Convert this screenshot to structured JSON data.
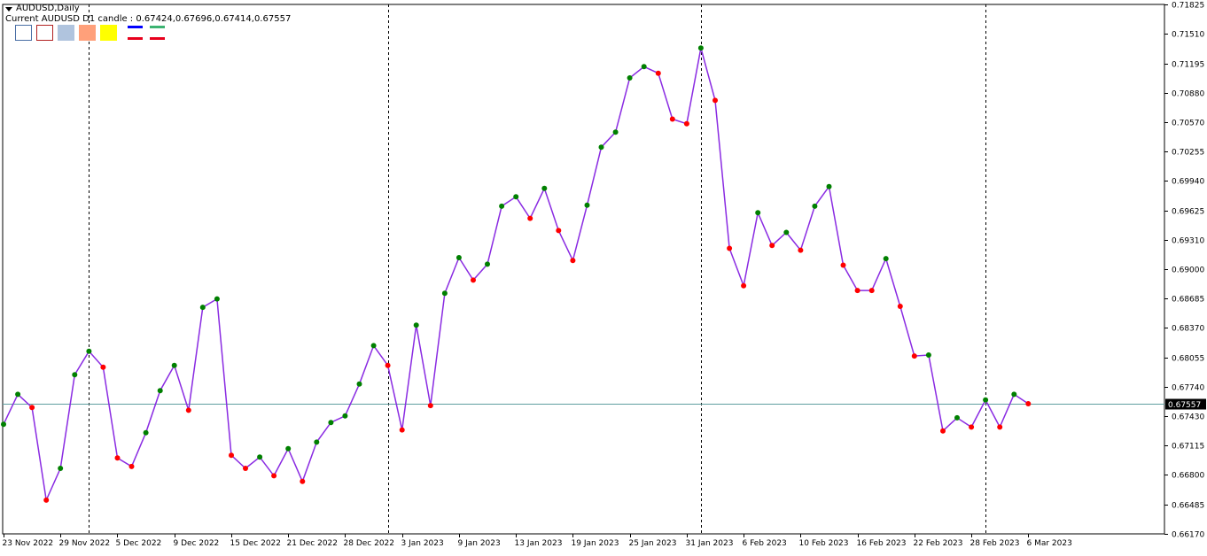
{
  "header": {
    "symbol_title": "AUDUSD,Daily",
    "info_line": "Current AUDUSD D1 candle : 0.67424,0.67696,0.67414,0.67557"
  },
  "legend": {
    "swatches": [
      {
        "name": "white-box-swatch",
        "fill": "#ffffff",
        "border": "#4a6fa5"
      },
      {
        "name": "white-red-box-swatch",
        "fill": "#ffffff",
        "border": "#b22222"
      },
      {
        "name": "lightsteelblue-swatch",
        "fill": "#b0c4de",
        "border": "#b0c4de"
      },
      {
        "name": "lightsalmon-swatch",
        "fill": "#ffa07a",
        "border": "#ffa07a"
      },
      {
        "name": "yellow-swatch",
        "fill": "#ffff00",
        "border": "#ffff00"
      }
    ],
    "line_pairs": [
      {
        "top": "#0000ff",
        "bottom": "#e8001c"
      },
      {
        "top": "#3cb371",
        "bottom": "#e8001c"
      }
    ]
  },
  "colors": {
    "line": "#8a2be2",
    "up_dot": "#008000",
    "down_dot": "#ff0000",
    "current_price_line": "#5f9ea0",
    "grid_line": "#000000"
  },
  "chart_data": {
    "type": "line",
    "title": "AUDUSD,Daily",
    "current_price": 0.67557,
    "current_price_label": "0.67557",
    "y_ticks": [
      "0.71825",
      "0.71510",
      "0.71195",
      "0.70880",
      "0.70570",
      "0.70255",
      "0.69940",
      "0.69625",
      "0.69310",
      "0.69000",
      "0.68685",
      "0.68370",
      "0.68055",
      "0.67740",
      "0.67430",
      "0.67115",
      "0.66800",
      "0.66485",
      "0.66170"
    ],
    "ylim": [
      0.6617,
      0.71825
    ],
    "x_labels": [
      "23 Nov 2022",
      "29 Nov 2022",
      "5 Dec 2022",
      "9 Dec 2022",
      "15 Dec 2022",
      "21 Dec 2022",
      "28 Dec 2022",
      "3 Jan 2023",
      "9 Jan 2023",
      "13 Jan 2023",
      "19 Jan 2023",
      "25 Jan 2023",
      "31 Jan 2023",
      "6 Feb 2023",
      "10 Feb 2023",
      "16 Feb 2023",
      "22 Feb 2023",
      "28 Feb 2023",
      "6 Mar 2023"
    ],
    "x_label_bar_index": [
      0,
      4,
      8,
      12,
      16,
      20,
      24,
      28,
      32,
      36,
      40,
      44,
      48,
      52,
      56,
      60,
      64,
      68,
      72
    ],
    "period_separator_bar_index": [
      6,
      27,
      49,
      69
    ],
    "series": [
      {
        "values": [
          0.6734,
          0.6766,
          0.6752,
          0.6653,
          0.6687,
          0.6787,
          0.6812,
          0.6795,
          0.6698,
          0.6689,
          0.6725,
          0.677,
          0.6797,
          0.6749,
          0.6859,
          0.6868,
          0.6701,
          0.6687,
          0.6699,
          0.6679,
          0.6708,
          0.6673,
          0.6715,
          0.6736,
          0.6743,
          0.6777,
          0.6818,
          0.6797,
          0.6728,
          0.684,
          0.6754,
          0.6874,
          0.6912,
          0.6888,
          0.6905,
          0.6967,
          0.6977,
          0.6954,
          0.6986,
          0.6941,
          0.6909,
          0.6968,
          0.703,
          0.7046,
          0.7104,
          0.7116,
          0.7109,
          0.706,
          0.7055,
          0.7136,
          0.708,
          0.6922,
          0.6882,
          0.696,
          0.6925,
          0.6939,
          0.692,
          0.6967,
          0.6988,
          0.6904,
          0.6877,
          0.6877,
          0.6911,
          0.686,
          0.6807,
          0.6808,
          0.6727,
          0.6741,
          0.6731,
          0.676,
          0.6731,
          0.6766,
          0.6756
        ],
        "direction": [
          "up",
          "up",
          "down",
          "down",
          "up",
          "up",
          "up",
          "down",
          "down",
          "down",
          "up",
          "up",
          "up",
          "down",
          "up",
          "up",
          "down",
          "down",
          "up",
          "down",
          "up",
          "down",
          "up",
          "up",
          "up",
          "up",
          "up",
          "down",
          "down",
          "up",
          "down",
          "up",
          "up",
          "down",
          "up",
          "up",
          "up",
          "down",
          "up",
          "down",
          "down",
          "up",
          "up",
          "up",
          "up",
          "up",
          "down",
          "down",
          "down",
          "up",
          "down",
          "down",
          "down",
          "up",
          "down",
          "up",
          "down",
          "up",
          "up",
          "down",
          "down",
          "down",
          "up",
          "down",
          "down",
          "up",
          "down",
          "up",
          "down",
          "up",
          "down",
          "up",
          "down"
        ]
      }
    ]
  }
}
